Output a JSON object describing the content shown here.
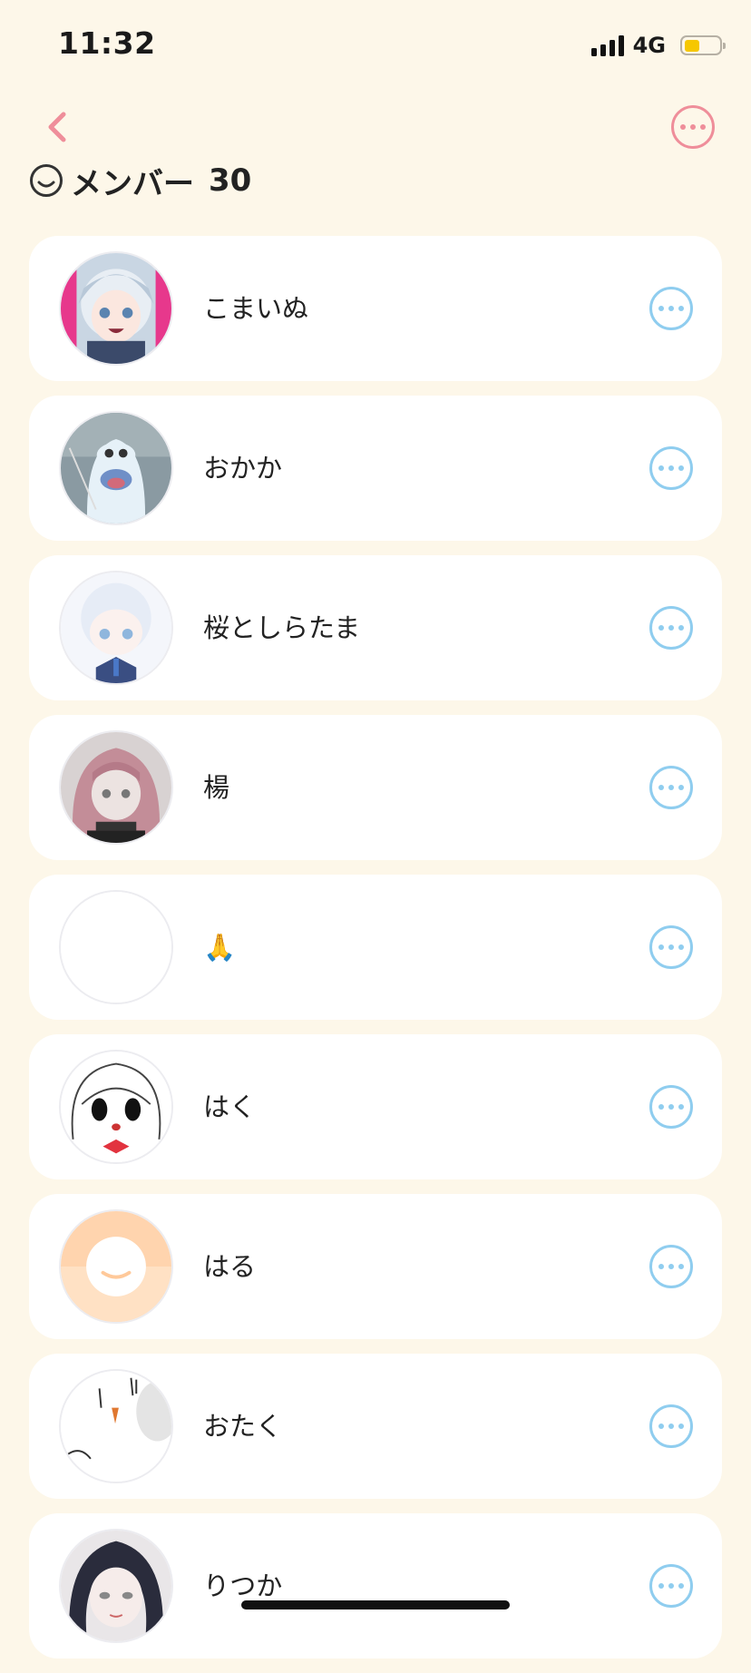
{
  "status_bar": {
    "time": "11:32",
    "network": "4G",
    "battery_level": 0.45,
    "battery_color": "#f6c700"
  },
  "nav": {
    "back_icon": "chevron-left-icon",
    "more_icon": "ellipsis-circle-icon",
    "accent_color": "#ef8e9a"
  },
  "section": {
    "icon": "smiley-face-icon",
    "title": "メンバー",
    "count": "30"
  },
  "members": [
    {
      "name": "こまいぬ",
      "avatar": "avatar-anime-silver-hair"
    },
    {
      "name": "おかか",
      "avatar": "avatar-ghost-character"
    },
    {
      "name": "桜としらたま",
      "avatar": "avatar-anime-white-hair"
    },
    {
      "name": "楊",
      "avatar": "avatar-anime-pink-hair"
    },
    {
      "name": "🙏",
      "avatar": "avatar-blank"
    },
    {
      "name": "はく",
      "avatar": "avatar-chibi-sketch"
    },
    {
      "name": "はる",
      "avatar": "avatar-default-smiley"
    },
    {
      "name": "おたく",
      "avatar": "avatar-sketch-bird"
    },
    {
      "name": "りつか",
      "avatar": "avatar-anime-dark-hair"
    }
  ],
  "row_more_icon": "ellipsis-circle-icon",
  "row_more_color": "#8fcdef",
  "background_color": "#fdf7e9"
}
